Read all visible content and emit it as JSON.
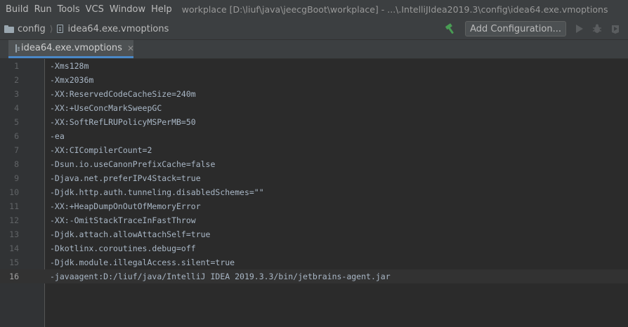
{
  "menu": {
    "items": [
      "Build",
      "Run",
      "Tools",
      "VCS",
      "Window",
      "Help"
    ],
    "window_title": "workplace [D:\\liuf\\java\\jeecgBoot\\workplace] - ...\\.IntelliJIdea2019.3\\config\\idea64.exe.vmoptions"
  },
  "navbar": {
    "breadcrumb_folder": "config",
    "breadcrumb_file": "idea64.exe.vmoptions",
    "config_button_label": "Add Configuration..."
  },
  "tabs": [
    {
      "label": "idea64.exe.vmoptions",
      "active": true
    }
  ],
  "editor": {
    "current_line": 16,
    "lines": [
      {
        "num": "1",
        "text": "-Xms128m"
      },
      {
        "num": "2",
        "text": "-Xmx2036m"
      },
      {
        "num": "3",
        "text": "-XX:ReservedCodeCacheSize=240m"
      },
      {
        "num": "4",
        "text": "-XX:+UseConcMarkSweepGC"
      },
      {
        "num": "5",
        "text": "-XX:SoftRefLRUPolicyMSPerMB=50"
      },
      {
        "num": "6",
        "text": "-ea"
      },
      {
        "num": "7",
        "text": "-XX:CICompilerCount=2"
      },
      {
        "num": "8",
        "text": "-Dsun.io.useCanonPrefixCache=false"
      },
      {
        "num": "9",
        "text": "-Djava.net.preferIPv4Stack=true"
      },
      {
        "num": "10",
        "text": "-Djdk.http.auth.tunneling.disabledSchemes=\"\""
      },
      {
        "num": "11",
        "text": "-XX:+HeapDumpOnOutOfMemoryError"
      },
      {
        "num": "12",
        "text": "-XX:-OmitStackTraceInFastThrow"
      },
      {
        "num": "13",
        "text": "-Djdk.attach.allowAttachSelf=true"
      },
      {
        "num": "14",
        "text": "-Dkotlinx.coroutines.debug=off"
      },
      {
        "num": "15",
        "text": "-Djdk.module.illegalAccess.silent=true"
      },
      {
        "num": "16",
        "text": "-javaagent:D:/liuf/java/IntelliJ IDEA 2019.3.3/bin/jetbrains-agent.jar"
      }
    ]
  },
  "colors": {
    "accent": "#4a88c7",
    "build_green": "#499c54",
    "background": "#2b2b2b"
  },
  "icons": [
    "folder-icon",
    "file-icon",
    "hammer-icon",
    "run-icon",
    "debug-icon",
    "coverage-icon",
    "close-icon"
  ]
}
